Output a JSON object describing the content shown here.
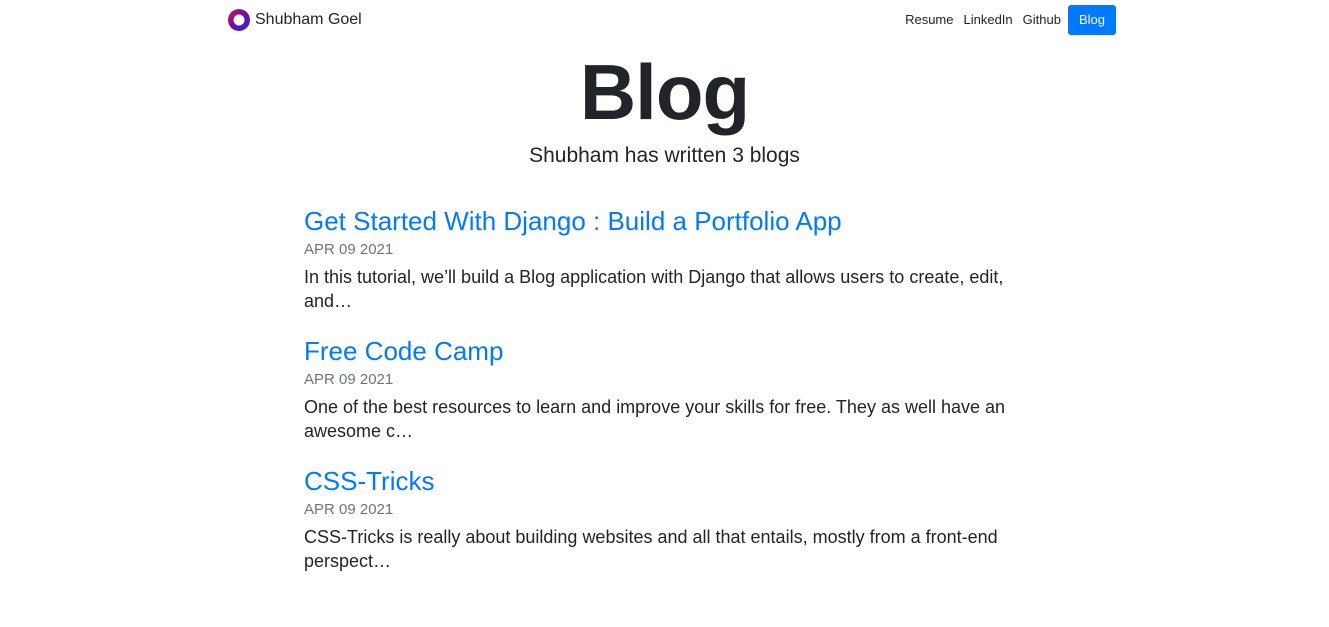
{
  "brand": {
    "name": "Shubham Goel"
  },
  "nav": {
    "items": [
      {
        "label": "Resume"
      },
      {
        "label": "LinkedIn"
      },
      {
        "label": "Github"
      },
      {
        "label": "Blog"
      }
    ]
  },
  "hero": {
    "title": "Blog",
    "subtitle": "Shubham has written 3 blogs"
  },
  "posts": [
    {
      "title": "Get Started With Django : Build a Portfolio App",
      "date": "APR 09 2021",
      "excerpt": "In this tutorial, we’ll build a Blog application with Django that allows users to create, edit, and…"
    },
    {
      "title": "Free Code Camp",
      "date": "APR 09 2021",
      "excerpt": "One of the best resources to learn and improve your skills for free. They as well have an awesome c…"
    },
    {
      "title": "CSS-Tricks",
      "date": "APR 09 2021",
      "excerpt": "CSS-Tricks is really about building websites and all that entails, mostly from a front-end perspect…"
    }
  ],
  "colors": {
    "accent": "#007bff",
    "text": "#212529",
    "muted": "#6c757d",
    "logo_gradient": [
      "#e0115f",
      "#6a0dad",
      "#2b2bd6"
    ]
  },
  "icons": {
    "brand_logo": "ring-logo-icon"
  }
}
